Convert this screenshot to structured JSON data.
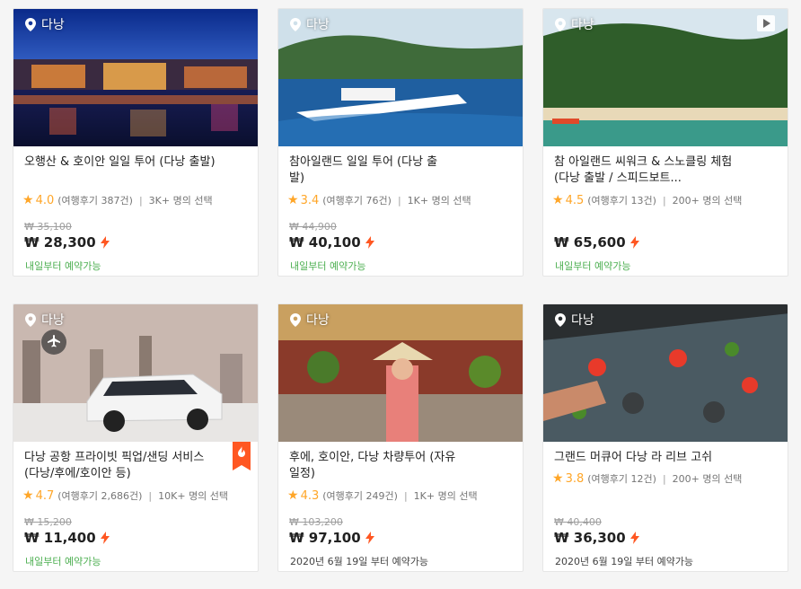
{
  "accent_color": "#ff5722",
  "available_color": "#4caf50",
  "star_color": "#ffa628",
  "cards": [
    {
      "location": "다낭",
      "title": "오행산 & 호이안 일일 투어 (다낭 출발)",
      "rating": "4.0",
      "reviews": "(여행후기 387건)",
      "booked": "3K+ 명의 선택",
      "original_price": "₩ 35,100",
      "price": "₩ 28,300",
      "availability": "내일부터 예약가능"
    },
    {
      "location": "다낭",
      "title": "참아일랜드 일일 투어 (다낭 출발)",
      "rating": "3.4",
      "reviews": "(여행후기 76건)",
      "booked": "1K+ 명의 선택",
      "original_price": "₩ 44,900",
      "price": "₩ 40,100",
      "availability": "내일부터 예약가능"
    },
    {
      "location": "다낭",
      "title": "참 아일랜드 씨워크 & 스노클링 체험 (다낭 출발 / 스피드보트...",
      "rating": "4.5",
      "reviews": "(여행후기 13건)",
      "booked": "200+ 명의 선택",
      "original_price": "",
      "price": "₩ 65,600",
      "availability": "내일부터 예약가능",
      "icon": "video-play-icon"
    },
    {
      "location": "다낭",
      "title": "다낭 공항 프라이빗 픽업/샌딩 서비스 (다낭/후에/호이안 등)",
      "rating": "4.7",
      "reviews": "(여행후기 2,686건)",
      "booked": "10K+ 명의 선택",
      "original_price": "₩ 15,200",
      "price": "₩ 11,400",
      "availability": "내일부터 예약가능",
      "icon": "airplane-icon"
    },
    {
      "location": "다낭",
      "title": "후에, 호이안, 다낭 차량투어 (자유일정)",
      "rating": "4.3",
      "reviews": "(여행후기 249건)",
      "booked": "1K+ 명의 선택",
      "original_price": "₩ 103,200",
      "price": "₩ 97,100",
      "availability": "2020년 6월 19일 부터 예약가능"
    },
    {
      "location": "다낭",
      "title": "그랜드 머큐어 다낭 라 리브 고쉬",
      "rating": "3.8",
      "reviews": "(여행후기 12건)",
      "booked": "200+ 명의 선택",
      "original_price": "₩ 40,400",
      "price": "₩ 36,300",
      "availability": "2020년 6월 19일 부터 예약가능"
    }
  ]
}
